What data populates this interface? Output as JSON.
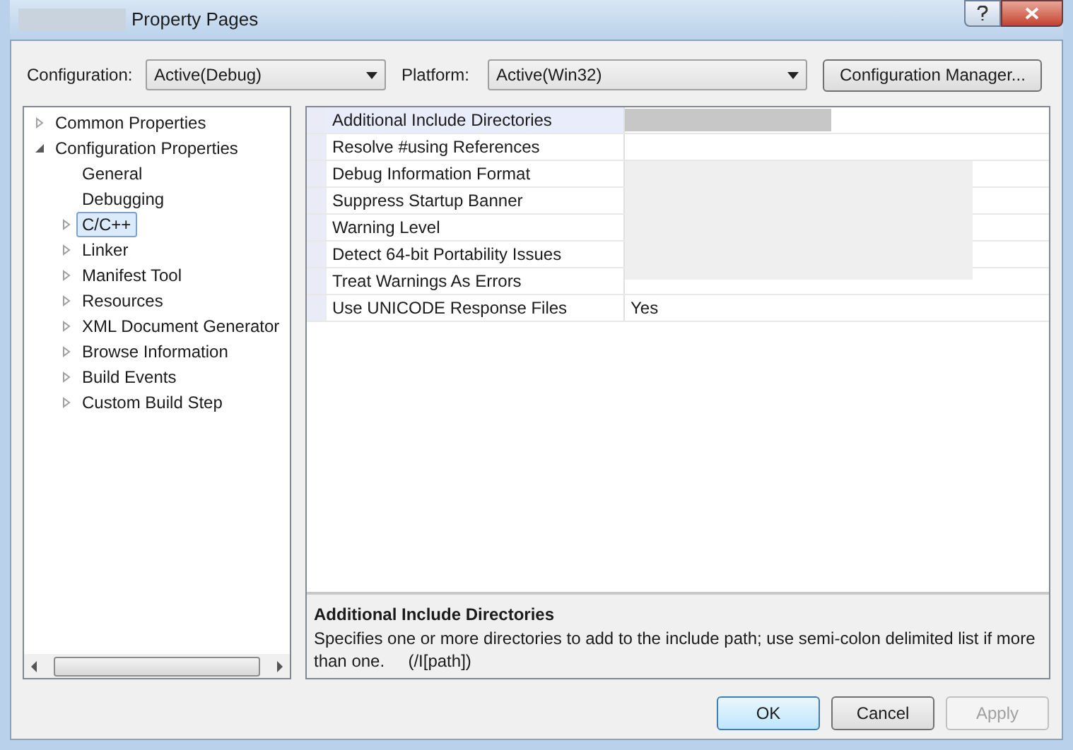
{
  "window": {
    "title": "Property Pages"
  },
  "toolbar": {
    "configuration": {
      "label": "Configuration:",
      "value": "Active(Debug)"
    },
    "platform": {
      "label": "Platform:",
      "value": "Active(Win32)"
    },
    "manager_button": "Configuration Manager..."
  },
  "tree": [
    {
      "label": "Common Properties",
      "expanded": false,
      "selected": false,
      "has_children": true
    },
    {
      "label": "Configuration Properties",
      "expanded": true,
      "selected": false,
      "has_children": true,
      "children": [
        {
          "label": "General",
          "expanded": false,
          "selected": false,
          "has_children": false
        },
        {
          "label": "Debugging",
          "expanded": false,
          "selected": false,
          "has_children": false
        },
        {
          "label": "C/C++",
          "expanded": false,
          "selected": true,
          "has_children": true
        },
        {
          "label": "Linker",
          "expanded": false,
          "selected": false,
          "has_children": true
        },
        {
          "label": "Manifest Tool",
          "expanded": false,
          "selected": false,
          "has_children": true
        },
        {
          "label": "Resources",
          "expanded": false,
          "selected": false,
          "has_children": true
        },
        {
          "label": "XML Document Generator",
          "expanded": false,
          "selected": false,
          "has_children": true
        },
        {
          "label": "Browse Information",
          "expanded": false,
          "selected": false,
          "has_children": true
        },
        {
          "label": "Build Events",
          "expanded": false,
          "selected": false,
          "has_children": true
        },
        {
          "label": "Custom Build Step",
          "expanded": false,
          "selected": false,
          "has_children": true
        }
      ]
    }
  ],
  "properties": [
    {
      "name": "Additional Include Directories",
      "selected": true
    },
    {
      "name": "Resolve #using References",
      "selected": false
    },
    {
      "name": "Debug Information Format",
      "selected": false
    },
    {
      "name": "Suppress Startup Banner",
      "selected": false
    },
    {
      "name": "Warning Level",
      "selected": false
    },
    {
      "name": "Detect 64-bit Portability Issues",
      "selected": false
    },
    {
      "name": "Treat Warnings As Errors",
      "selected": false
    },
    {
      "name": "Use UNICODE Response Files",
      "selected": false,
      "value": "Yes"
    }
  ],
  "description": {
    "title": "Additional Include Directories",
    "text": "Specifies one or more directories to add to the include path; use semi-colon delimited list if more than one.     (/I[path])"
  },
  "buttons": [
    {
      "label": "OK",
      "default": true,
      "disabled": false
    },
    {
      "label": "Cancel",
      "default": false,
      "disabled": false
    },
    {
      "label": "Apply",
      "default": false,
      "disabled": true
    }
  ]
}
